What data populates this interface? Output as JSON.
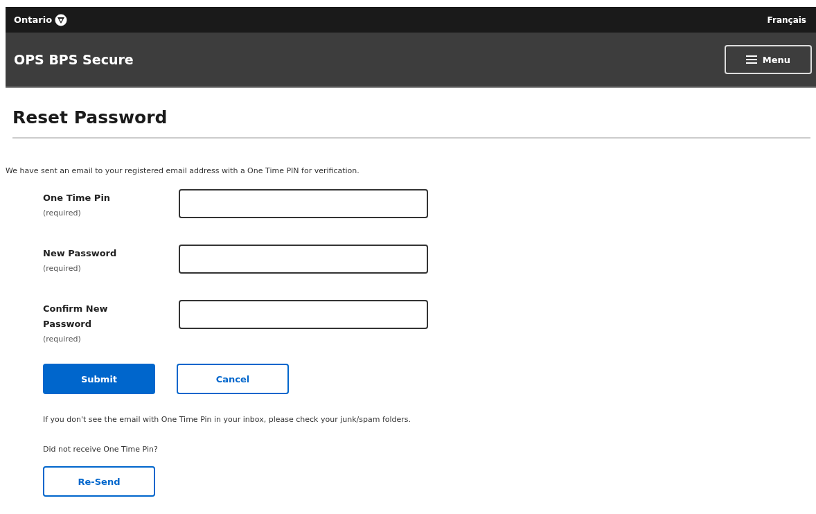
{
  "top_bar": {
    "brand": "Ontario",
    "language_link": "Français"
  },
  "header": {
    "title": "OPS BPS Secure",
    "menu_button": "Menu"
  },
  "page_title": "Reset Password",
  "intro": "We have sent an email to your registered email address with a One Time PIN for verification.",
  "fields": [
    {
      "label": "One Time Pin",
      "hint": "(required)"
    },
    {
      "label": "New Password",
      "hint": "(required)"
    },
    {
      "label": "Confirm New Password",
      "hint": "(required)"
    }
  ],
  "buttons": [
    {
      "label": "Submit",
      "kind": "primary"
    },
    {
      "label": "Cancel",
      "kind": "secondary"
    }
  ],
  "spam_note": "If you don't see the email with One Time Pin in your inbox, please check your junk/spam folders.",
  "resend_prompt": "Did not receive One Time Pin?",
  "resend_button": {
    "label": "Re-Send",
    "kind": "secondary"
  }
}
